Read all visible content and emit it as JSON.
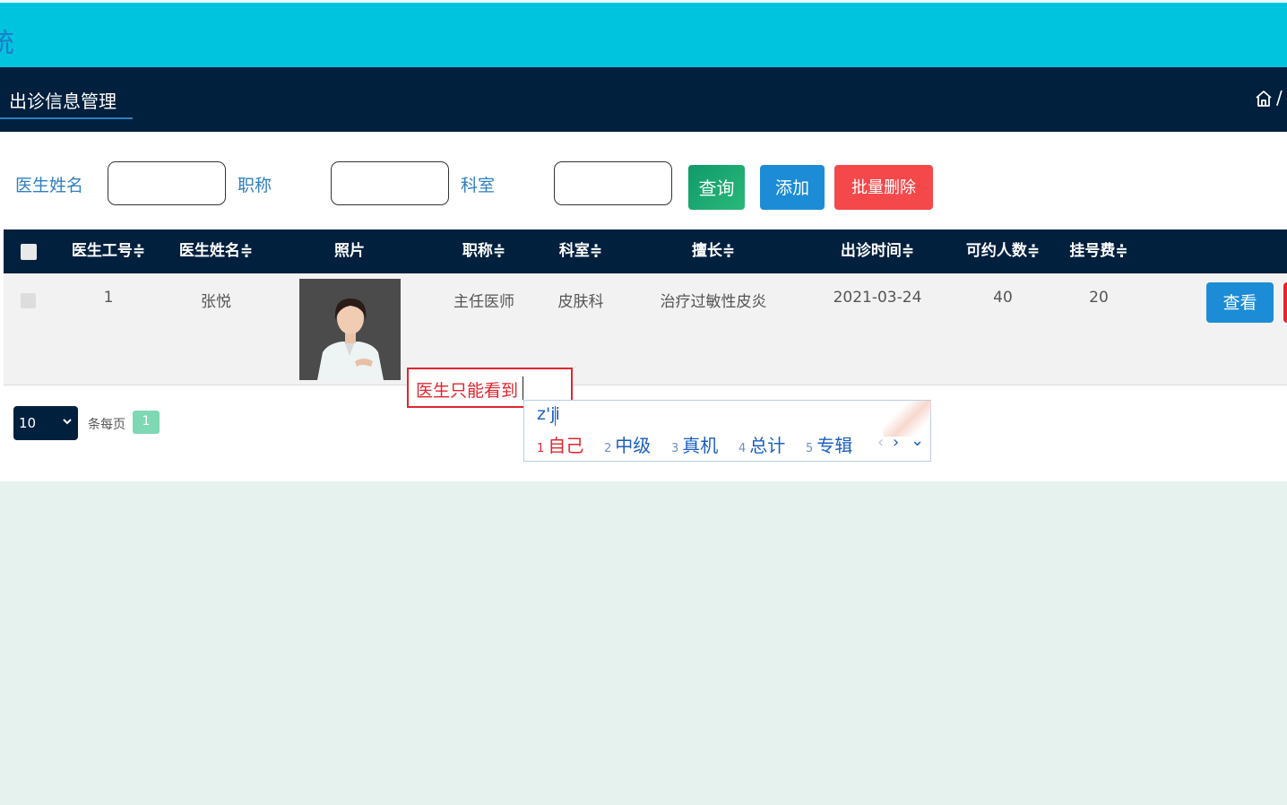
{
  "header": {
    "system_title_fragment": "统"
  },
  "nav": {
    "active_tab": "出诊信息管理",
    "breadcrumb_separator": "/"
  },
  "filters": {
    "doctor_name_label": "医生姓名",
    "title_label": "职称",
    "department_label": "科室",
    "doctor_name_value": "",
    "title_value": "",
    "department_value": ""
  },
  "buttons": {
    "query": "查询",
    "add": "添加",
    "batch_delete": "批量删除",
    "view": "查看"
  },
  "table": {
    "columns": [
      "医生工号≑",
      "医生姓名≑",
      "照片",
      "职称≑",
      "科室≑",
      "擅长≑",
      "出诊时间≑",
      "可约人数≑",
      "挂号费≑"
    ],
    "rows": [
      {
        "doctor_id": "1",
        "doctor_name": "张悦",
        "title": "主任医师",
        "department": "皮肤科",
        "specialty": "治疗过敏性皮炎",
        "visit_date": "2021-03-24",
        "capacity": "40",
        "fee": "20"
      }
    ]
  },
  "pagination": {
    "page_size": "10",
    "per_page_text": "条每页",
    "current_page": "1"
  },
  "tooltip_input": {
    "text": "医生只能看到"
  },
  "ime": {
    "composition": "z'ji",
    "candidates": [
      {
        "num": "1",
        "text": "自己"
      },
      {
        "num": "2",
        "text": "中级"
      },
      {
        "num": "3",
        "text": "真机"
      },
      {
        "num": "4",
        "text": "总计"
      },
      {
        "num": "5",
        "text": "专辑"
      }
    ],
    "nav_prev": "‹",
    "nav_next": "›",
    "nav_expand": "⌄"
  },
  "colors": {
    "header_bg": "#00c4dd",
    "nav_bg": "#01203e",
    "accent_blue": "#1c8cd6",
    "danger_red": "#f5484a",
    "success_green": "#0f9a6a"
  }
}
